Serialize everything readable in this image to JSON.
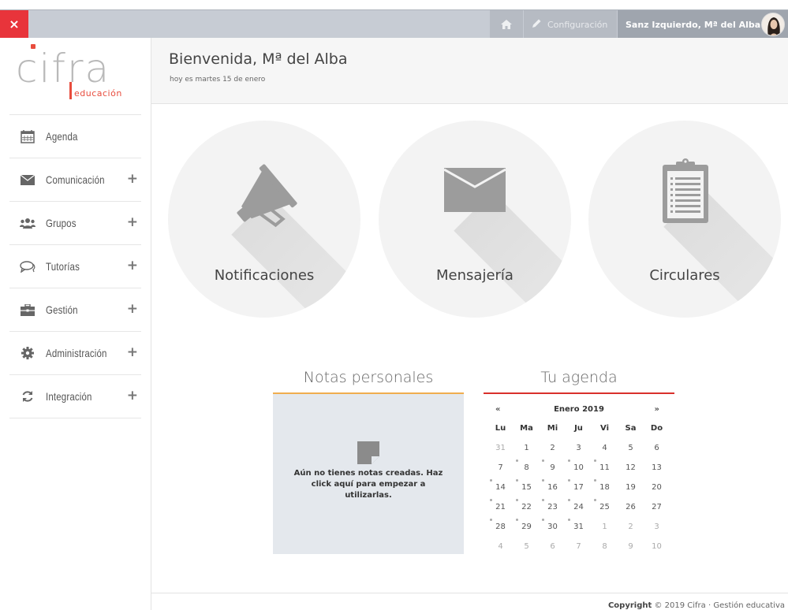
{
  "topbar": {
    "close_symbol": "×",
    "home_icon": "home-icon",
    "config_label": "Configuración",
    "config_icon": "pencil-icon",
    "user_name": "Sanz Izquierdo, Mª del Alba",
    "caret": "▾"
  },
  "logo": {
    "word": "cifra",
    "sub": "educación",
    "accent_color": "#e84c3d"
  },
  "sidebar": {
    "items": [
      {
        "label": "Agenda",
        "icon": "calendar-icon",
        "expandable": false
      },
      {
        "label": "Comunicación",
        "icon": "envelope-icon",
        "expandable": true
      },
      {
        "label": "Grupos",
        "icon": "users-icon",
        "expandable": true
      },
      {
        "label": "Tutorías",
        "icon": "chat-icon",
        "expandable": true
      },
      {
        "label": "Gestión",
        "icon": "briefcase-icon",
        "expandable": true
      },
      {
        "label": "Administración",
        "icon": "gear-icon",
        "expandable": true
      },
      {
        "label": "Integración",
        "icon": "refresh-icon",
        "expandable": true
      }
    ],
    "plus": "+"
  },
  "header": {
    "title": "Bienvenida, Mª del Alba",
    "subtitle": "hoy es martes 15 de enero"
  },
  "tiles": [
    {
      "label": "Notificaciones",
      "icon": "megaphone-icon"
    },
    {
      "label": "Mensajería",
      "icon": "envelope-icon"
    },
    {
      "label": "Circulares",
      "icon": "clipboard-icon"
    }
  ],
  "notes": {
    "title": "Notas personales",
    "empty_text": "Aún no tienes notas creadas. Haz click aquí para empezar a utilizarlas.",
    "accent_color": "#f0ad4e"
  },
  "agenda": {
    "title": "Tu agenda",
    "prev": "«",
    "next": "»",
    "month": "Enero 2019",
    "accent_color": "#d9302b",
    "weekdays": [
      "Lu",
      "Ma",
      "Mi",
      "Ju",
      "Vi",
      "Sa",
      "Do"
    ],
    "weeks": [
      [
        {
          "d": "31",
          "m": true
        },
        {
          "d": "1"
        },
        {
          "d": "2"
        },
        {
          "d": "3"
        },
        {
          "d": "4"
        },
        {
          "d": "5"
        },
        {
          "d": "6"
        }
      ],
      [
        {
          "d": "7"
        },
        {
          "d": "8",
          "e": true
        },
        {
          "d": "9",
          "e": true
        },
        {
          "d": "10",
          "e": true
        },
        {
          "d": "11",
          "e": true
        },
        {
          "d": "12"
        },
        {
          "d": "13"
        }
      ],
      [
        {
          "d": "14",
          "e": true
        },
        {
          "d": "15",
          "e": true
        },
        {
          "d": "16",
          "e": true
        },
        {
          "d": "17",
          "e": true
        },
        {
          "d": "18",
          "e": true
        },
        {
          "d": "19"
        },
        {
          "d": "20"
        }
      ],
      [
        {
          "d": "21",
          "e": true
        },
        {
          "d": "22",
          "e": true
        },
        {
          "d": "23",
          "e": true
        },
        {
          "d": "24",
          "e": true
        },
        {
          "d": "25",
          "e": true
        },
        {
          "d": "26"
        },
        {
          "d": "27"
        }
      ],
      [
        {
          "d": "28",
          "e": true
        },
        {
          "d": "29",
          "e": true
        },
        {
          "d": "30",
          "e": true
        },
        {
          "d": "31",
          "e": true
        },
        {
          "d": "1",
          "m": true
        },
        {
          "d": "2",
          "m": true
        },
        {
          "d": "3",
          "m": true
        }
      ],
      [
        {
          "d": "4",
          "m": true
        },
        {
          "d": "5",
          "m": true
        },
        {
          "d": "6",
          "m": true
        },
        {
          "d": "7",
          "m": true
        },
        {
          "d": "8",
          "m": true
        },
        {
          "d": "9",
          "m": true
        },
        {
          "d": "10",
          "m": true
        }
      ]
    ]
  },
  "footer": {
    "copyright_label": "Copyright",
    "copyright_text": "© 2019 Cifra · Gestión educativa"
  }
}
